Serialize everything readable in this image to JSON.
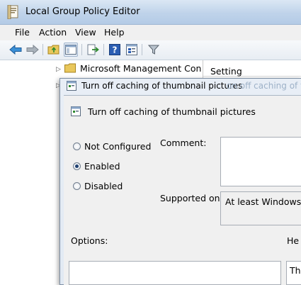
{
  "window": {
    "title": "Local Group Policy Editor"
  },
  "menu": {
    "items": [
      "File",
      "Action",
      "View",
      "Help"
    ]
  },
  "toolbar": {
    "icons": [
      "back-icon",
      "forward-icon",
      "up-folder-icon",
      "show-hide-tree-icon",
      "export-list-icon",
      "help-icon",
      "properties-icon",
      "filter-icon"
    ]
  },
  "tree": {
    "item": "Microsoft Management Cons"
  },
  "list": {
    "column_header": "Setting"
  },
  "dialog": {
    "title": "Turn off caching of thumbnail pictures",
    "ghost_title": "on off caching of thu",
    "policy_name": "Turn off caching of thumbnail pictures",
    "options": [
      {
        "label": "Not Configured",
        "selected": false
      },
      {
        "label": "Enabled",
        "selected": true
      },
      {
        "label": "Disabled",
        "selected": false
      }
    ],
    "comment_label": "Comment:",
    "supported_label": "Supported on:",
    "supported_value": "At least Windows XP",
    "options_label": "Options:",
    "help_label": "He",
    "help_text_start": "Th"
  },
  "colors": {
    "accent": "#1e3f70",
    "titlebar": "#bfd3ea"
  }
}
